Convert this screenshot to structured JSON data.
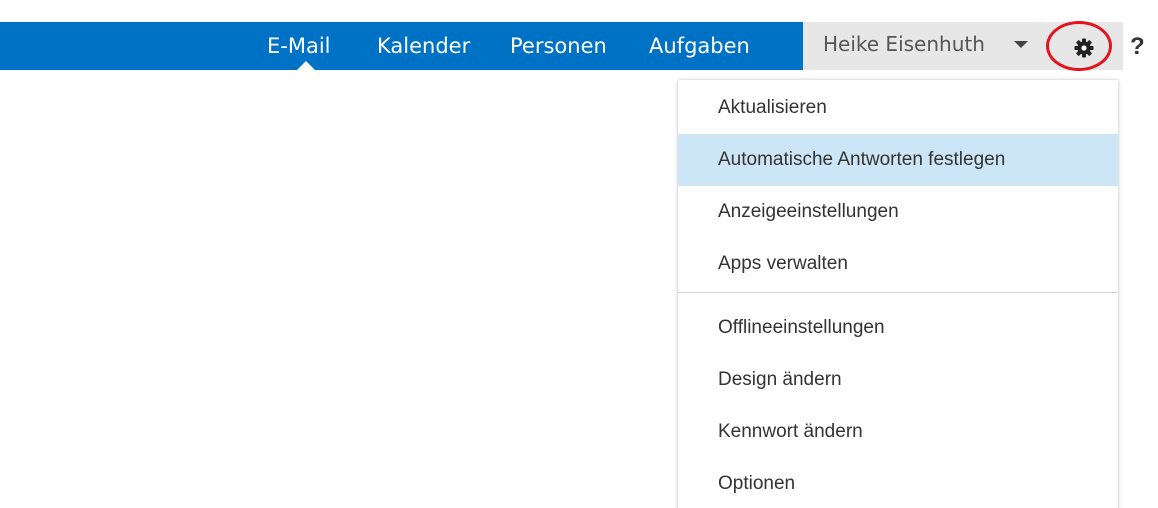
{
  "nav": {
    "items": [
      "E-Mail",
      "Kalender",
      "Personen",
      "Aufgaben"
    ],
    "active": "E-Mail"
  },
  "user": {
    "name": "Heike Eisenhuth"
  },
  "toolbar": {
    "settings_icon": "gear-icon",
    "help_label": "?"
  },
  "settings_menu": {
    "group1": [
      "Aktualisieren",
      "Automatische Antworten festlegen",
      "Anzeigeeinstellungen",
      "Apps verwalten"
    ],
    "group2": [
      "Offlineeinstellungen",
      "Design ändern",
      "Kennwort ändern",
      "Optionen"
    ],
    "highlighted": "Automatische Antworten festlegen"
  },
  "colors": {
    "nav_bar": "#0072c6",
    "user_bar": "#e7e7e7",
    "menu_highlight": "#cde6f7",
    "annotation_circle": "#e3141e"
  }
}
